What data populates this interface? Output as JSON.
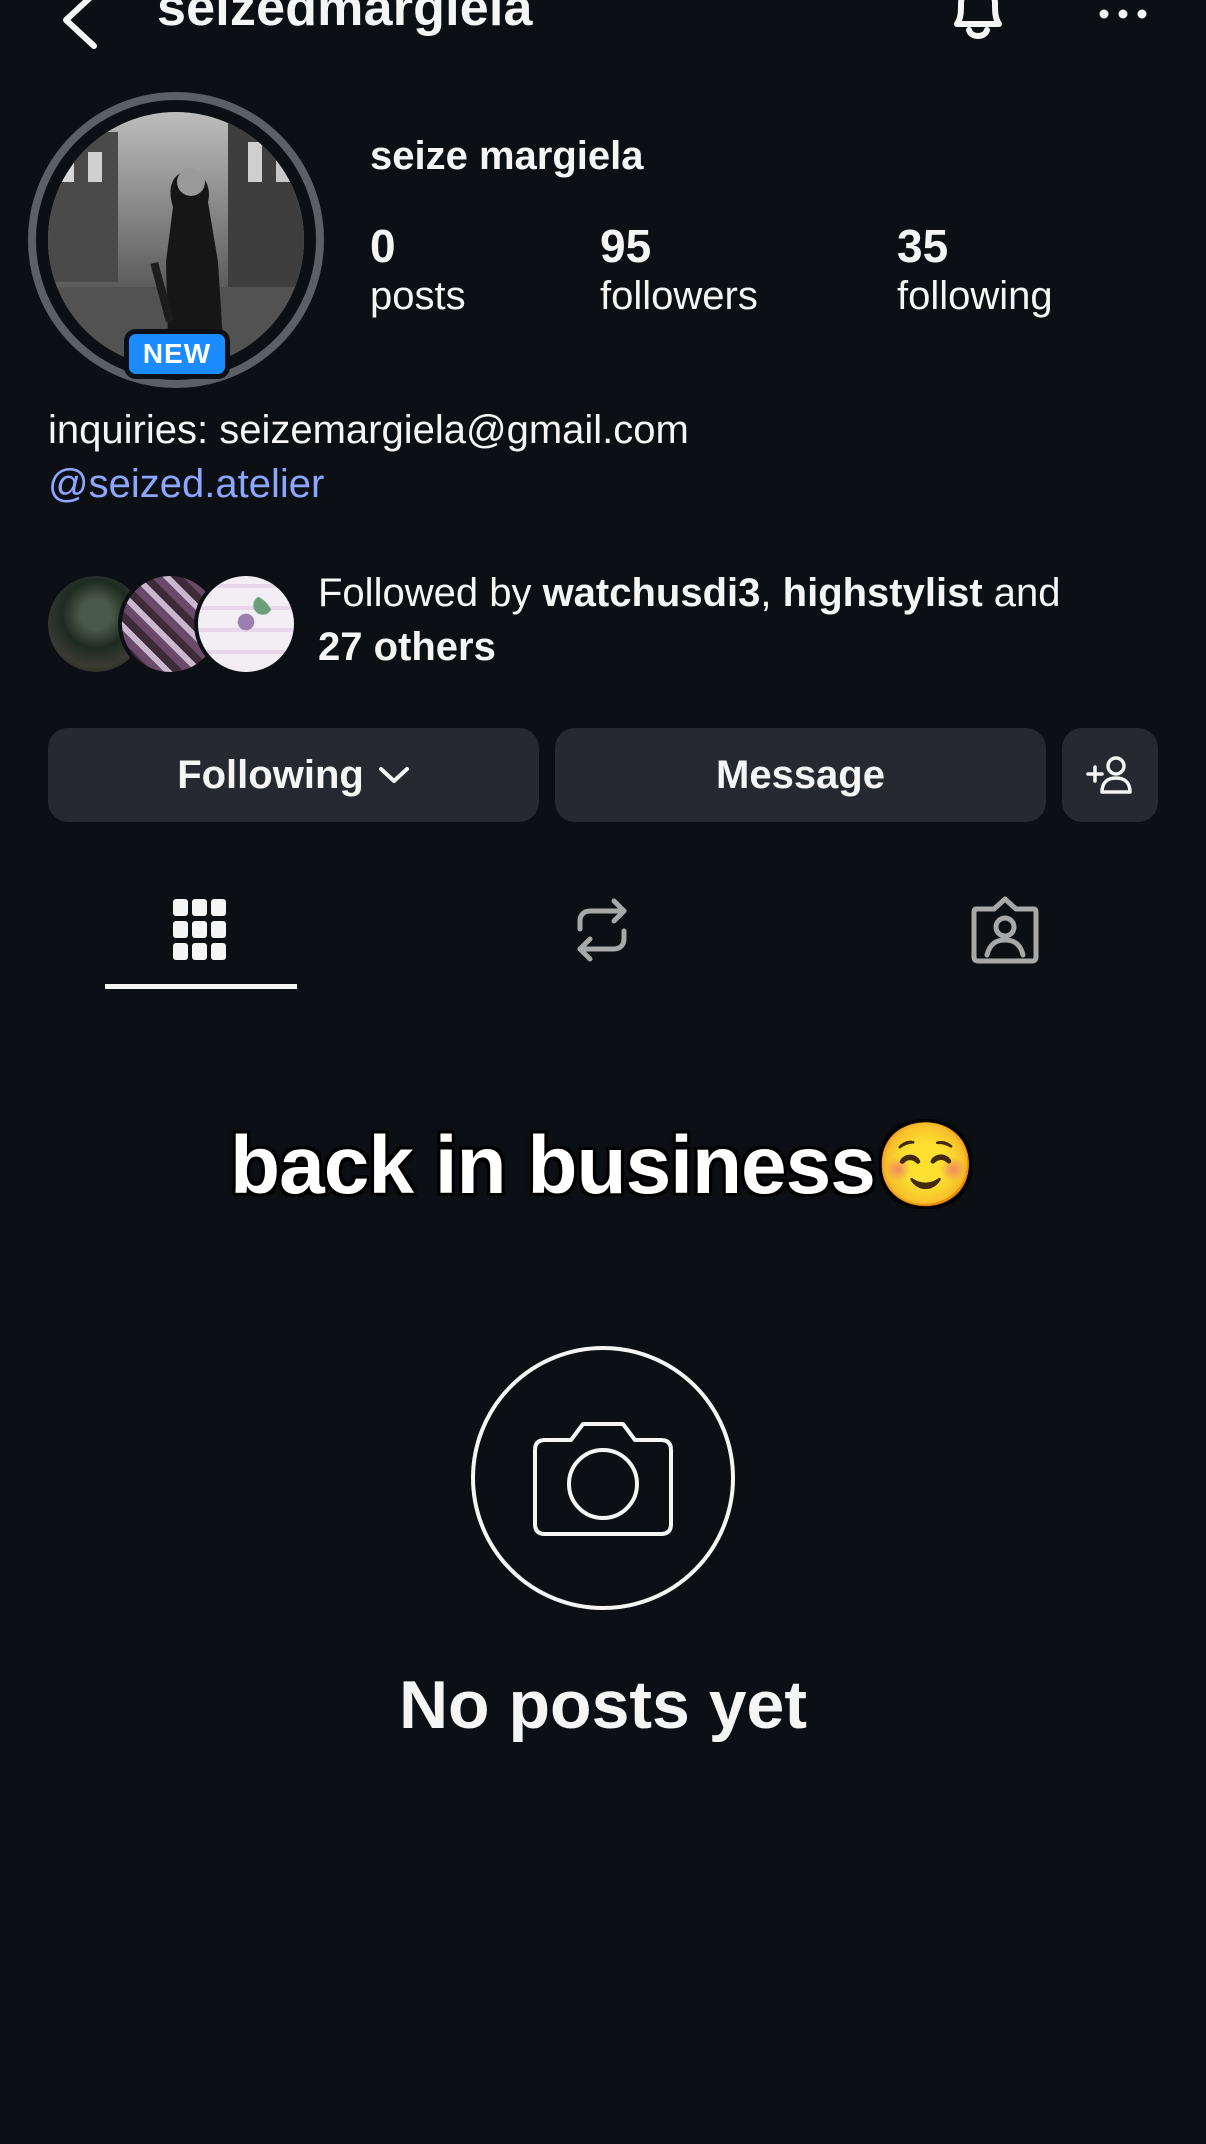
{
  "header": {
    "username": "seizedmargiela",
    "icons": {
      "back": "chevron-left-icon",
      "notifications": "bell-icon",
      "more": "more-horizontal-icon"
    }
  },
  "profile": {
    "new_badge": "NEW",
    "display_name": "seize margiela",
    "stats": {
      "posts_count": "0",
      "posts_label": "posts",
      "followers_count": "95",
      "followers_label": "followers",
      "following_count": "35",
      "following_label": "following"
    },
    "bio": "inquiries: seizemargiela@gmail.com",
    "bio_link": "@seized.atelier"
  },
  "followed_by": {
    "prefix": "Followed by ",
    "user1": "watchusdi3",
    "sep": ", ",
    "user2": "highstylist",
    "conj": " and",
    "others": "27 others"
  },
  "actions": {
    "following_label": "Following",
    "message_label": "Message",
    "icons": {
      "following_dropdown": "chevron-down-icon",
      "add_user": "add-user-icon"
    }
  },
  "tabs": [
    {
      "icon": "grid-icon",
      "active": true
    },
    {
      "icon": "repost-icon",
      "active": false
    },
    {
      "icon": "tagged-icon",
      "active": false
    }
  ],
  "content": {
    "caption": "back in business☺️",
    "empty_title": "No posts yet",
    "icon": "camera-icon"
  },
  "colors": {
    "background": "#0c1014",
    "button": "#262a30",
    "link": "#8da6ff",
    "badge": "#1a8cff"
  }
}
